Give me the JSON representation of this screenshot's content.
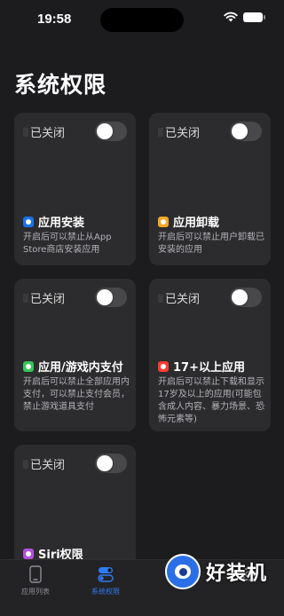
{
  "status_bar": {
    "time": "19:58"
  },
  "page": {
    "title": "系统权限"
  },
  "cards": [
    {
      "status": "已关闭",
      "toggle_on": false,
      "icon": "app-store-icon",
      "icon_color": "#1a73e8",
      "title": "应用安装",
      "description": "开启后可以禁止从App Store商店安装应用"
    },
    {
      "status": "已关闭",
      "toggle_on": false,
      "icon": "uninstall-icon",
      "icon_color": "#f5a623",
      "title": "应用卸载",
      "description": "开启后可以禁止用户卸载已安装的应用"
    },
    {
      "status": "已关闭",
      "toggle_on": false,
      "icon": "in-app-purchase-icon",
      "icon_color": "#34c759",
      "title": "应用/游戏内支付",
      "description": "开启后可以禁止全部应用内支付，可以禁止支付会员，禁止游戏道具支付"
    },
    {
      "status": "已关闭",
      "toggle_on": false,
      "icon": "age-rating-icon",
      "icon_color": "#ff3b30",
      "title": "17+以上应用",
      "description": "开启后可以禁止下载和显示17岁及以上的应用(可能包含成人内容、暴力场景、恐怖元素等)"
    },
    {
      "status": "已关闭",
      "toggle_on": false,
      "icon": "siri-icon",
      "icon_color": "#af52de",
      "title": "Siri权限",
      "description": ""
    }
  ],
  "tabbar": {
    "items": [
      {
        "label": "应用列表",
        "icon": "phone-icon",
        "active": false
      },
      {
        "label": "系统权限",
        "icon": "toggles-icon",
        "active": true
      },
      {
        "label": "",
        "icon": "globe-icon",
        "active": false
      },
      {
        "label": "",
        "icon": "gear-icon",
        "active": false
      }
    ],
    "active_color": "#2f7bf6",
    "inactive_color": "#8e8e93"
  },
  "watermark": {
    "text": "好装机"
  }
}
